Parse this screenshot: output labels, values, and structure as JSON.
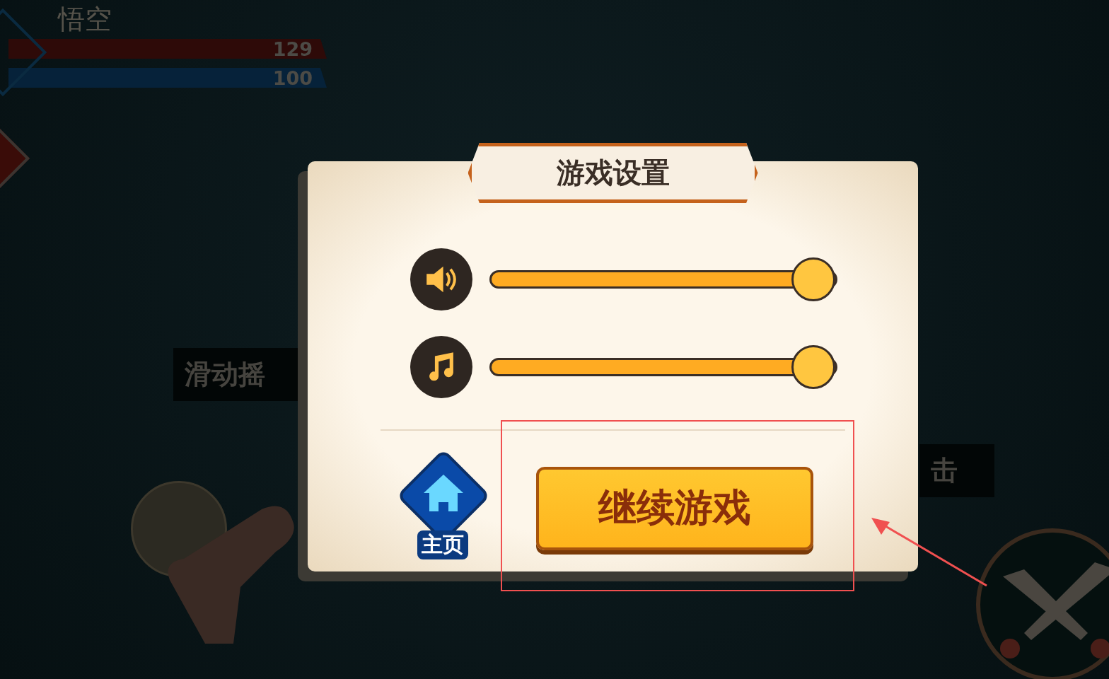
{
  "hud": {
    "name": "悟空",
    "hp": "129",
    "mp": "100"
  },
  "background_labels": [
    {
      "text": "滑动摇"
    },
    {
      "text": "击"
    }
  ],
  "dialog": {
    "title": "游戏设置",
    "sliders": [
      {
        "kind": "sound",
        "level": 1
      },
      {
        "kind": "music",
        "level": 1
      }
    ],
    "home_label": "主页",
    "continue_button": "继续游戏"
  }
}
